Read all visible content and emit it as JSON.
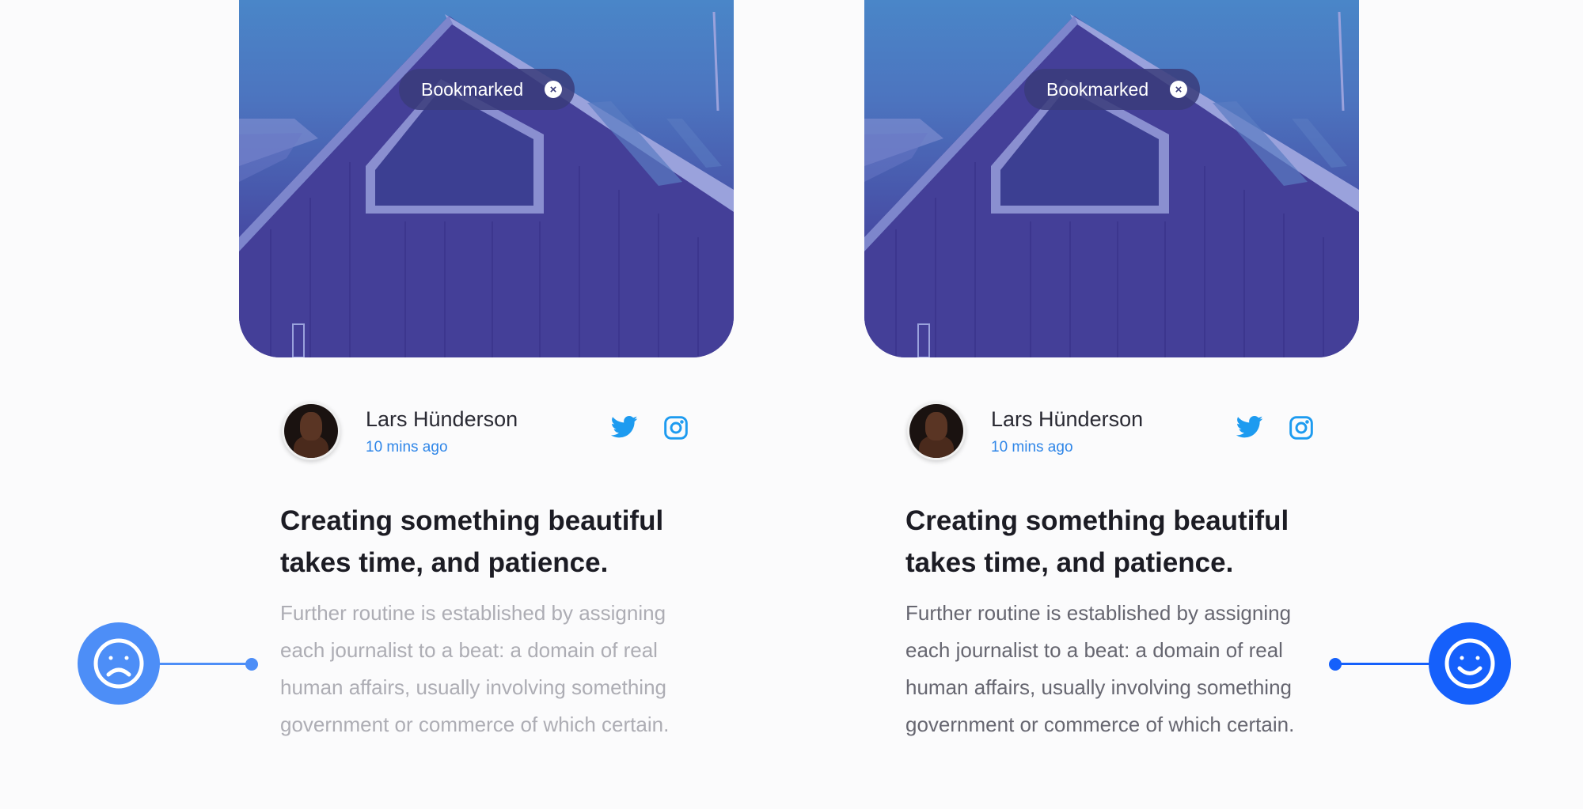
{
  "cards": [
    {
      "badge_label": "Bookmarked",
      "author_name": "Lars Hünderson",
      "time_ago": "10 mins ago",
      "title": "Creating something beautiful takes time, and patience.",
      "body": "Further routine is established by assigning each journalist to a beat: a domain of real human affairs, usually involving something government or commerce of which certain."
    },
    {
      "badge_label": "Bookmarked",
      "author_name": "Lars Hünderson",
      "time_ago": "10 mins ago",
      "title": "Creating something beautiful takes time, and patience.",
      "body": "Further routine is established by assigning each journalist to a beat: a domain of real human affairs, usually involving something government or commerce of which certain."
    }
  ],
  "colors": {
    "accent_light": "#4d8ef7",
    "accent_strong": "#1560fb",
    "link": "#2f86e8",
    "twitter": "#1d9bf0"
  },
  "icons": {
    "badge_remove": "close-icon",
    "social": [
      "twitter-icon",
      "instagram-icon"
    ],
    "reactions": [
      "sad-face-icon",
      "happy-face-icon"
    ]
  }
}
